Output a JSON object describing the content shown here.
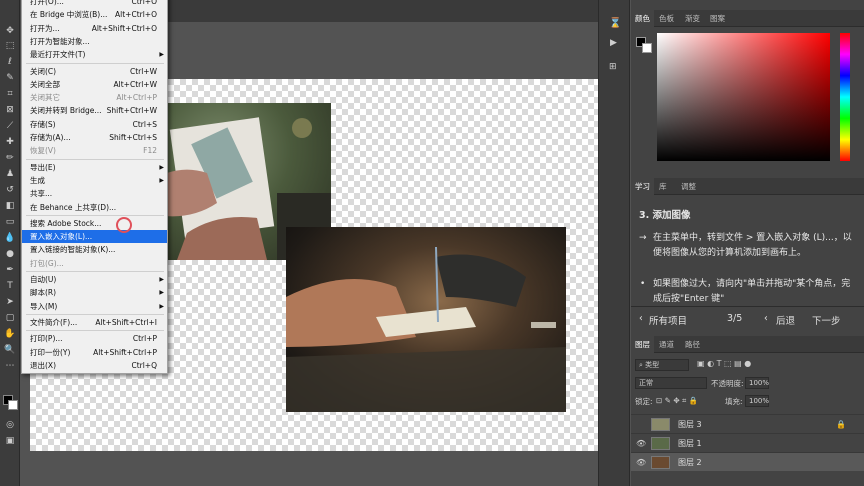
{
  "file_menu": {
    "items": [
      {
        "label": "打开(O)...",
        "shortcut": "Ctrl+O",
        "disabled": false
      },
      {
        "label": "在 Bridge 中浏览(B)...",
        "shortcut": "Alt+Ctrl+O",
        "disabled": false
      },
      {
        "label": "打开为...",
        "shortcut": "Alt+Shift+Ctrl+O",
        "disabled": false
      },
      {
        "label": "打开为智能对象...",
        "shortcut": "",
        "disabled": false
      },
      {
        "label": "最近打开文件(T)",
        "shortcut": "",
        "submenu": true,
        "disabled": false
      },
      {
        "label": "关闭(C)",
        "shortcut": "Ctrl+W",
        "disabled": false
      },
      {
        "label": "关闭全部",
        "shortcut": "Alt+Ctrl+W",
        "disabled": false
      },
      {
        "label": "关闭其它",
        "shortcut": "Alt+Ctrl+P",
        "disabled": true
      },
      {
        "label": "关闭并转到 Bridge...",
        "shortcut": "Shift+Ctrl+W",
        "disabled": false
      },
      {
        "label": "存储(S)",
        "shortcut": "Ctrl+S",
        "disabled": false
      },
      {
        "label": "存储为(A)...",
        "shortcut": "Shift+Ctrl+S",
        "disabled": false
      },
      {
        "label": "恢复(V)",
        "shortcut": "F12",
        "disabled": true
      },
      {
        "label": "导出(E)",
        "shortcut": "",
        "submenu": true,
        "disabled": false
      },
      {
        "label": "生成",
        "shortcut": "",
        "submenu": true,
        "disabled": false
      },
      {
        "label": "共享...",
        "shortcut": "",
        "disabled": false
      },
      {
        "label": "在 Behance 上共享(D)...",
        "shortcut": "",
        "disabled": false
      },
      {
        "label": "搜索 Adobe Stock...",
        "shortcut": "",
        "disabled": false
      },
      {
        "label": "置入嵌入对象(L)...",
        "shortcut": "",
        "disabled": false,
        "highlighted": true
      },
      {
        "label": "置入链接的智能对象(K)...",
        "shortcut": "",
        "disabled": false
      },
      {
        "label": "打包(G)...",
        "shortcut": "",
        "disabled": true
      },
      {
        "label": "自动(U)",
        "shortcut": "",
        "submenu": true,
        "disabled": false
      },
      {
        "label": "脚本(R)",
        "shortcut": "",
        "submenu": true,
        "disabled": false
      },
      {
        "label": "导入(M)",
        "shortcut": "",
        "submenu": true,
        "disabled": false
      },
      {
        "label": "文件简介(F)...",
        "shortcut": "Alt+Shift+Ctrl+I",
        "disabled": false
      },
      {
        "label": "打印(P)...",
        "shortcut": "Ctrl+P",
        "disabled": false
      },
      {
        "label": "打印一份(Y)",
        "shortcut": "Alt+Shift+Ctrl+P",
        "disabled": false
      },
      {
        "label": "退出(X)",
        "shortcut": "Ctrl+Q",
        "disabled": false
      }
    ]
  },
  "color_panel": {
    "tabs": [
      "颜色",
      "色板",
      "渐变",
      "图案"
    ],
    "foreground": "#000000",
    "background": "#ffffff"
  },
  "learn_panel": {
    "tabs": [
      "学习",
      "库",
      "调整"
    ],
    "heading": "3. 添加图像",
    "step1": "在主菜单中，转到文件 > 置入嵌入对象 (L)...，以便将图像从您的计算机添加到画布上。",
    "step2": "如果图像过大，请向内\"单击并拖动\"某个角点，完成后按\"Enter 键\"",
    "all_projects": "所有项目",
    "progress": "3/5",
    "back": "后退",
    "next": "下一步"
  },
  "layers_panel": {
    "tabs": [
      "图层",
      "通道",
      "路径"
    ],
    "filter_kind": "类型",
    "blend_mode": "正常",
    "opacity_label": "不透明度:",
    "opacity_value": "100%",
    "lock_label": "锁定:",
    "fill_label": "填充:",
    "fill_value": "100%",
    "layers": [
      {
        "name": "图层 3",
        "visible": false,
        "locked": true,
        "selected": false
      },
      {
        "name": "图层 1",
        "visible": true,
        "locked": false,
        "selected": false
      },
      {
        "name": "图层 2",
        "visible": true,
        "locked": false,
        "selected": true
      }
    ]
  },
  "colors": {
    "highlight": "#1e6ee8",
    "panel_bg": "#434343",
    "menu_bg": "#f0f0f0"
  }
}
